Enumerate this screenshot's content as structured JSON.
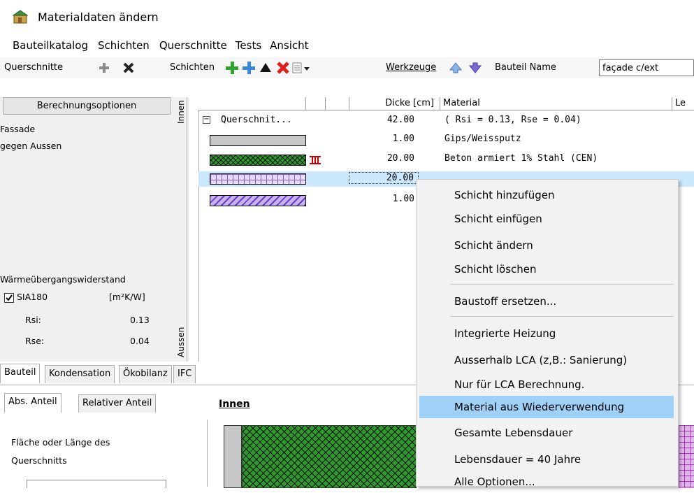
{
  "window": {
    "title": "Materialdaten ändern"
  },
  "menu": [
    "Bauteilkatalog",
    "Schichten",
    "Querschnitte",
    "Tests",
    "Ansicht"
  ],
  "toolbar": {
    "querschnitte_label": "Querschnitte",
    "schichten_label": "Schichten",
    "werkzeuge_label": "Werkzeuge",
    "bauteil_name_label": "Bauteil Name",
    "bauteil_name_value": "façade c/ext"
  },
  "left": {
    "calc_button": "Berechnungsoptionen",
    "innen": "Innen",
    "aussen": "Aussen",
    "desc_line1": "Fassade",
    "desc_line2": "gegen Aussen",
    "resistance_title": "Wärmeübergangswiderstand",
    "sia_label": "SIA180",
    "unit": "[m²K/W]",
    "rsi_label": "Rsi:",
    "rsi_value": "0.13",
    "rse_label": "Rse:",
    "rse_value": "0.04"
  },
  "grid": {
    "headers": {
      "dicke": "Dicke [cm]",
      "material": "Material",
      "le": "Le"
    },
    "rows": [
      {
        "name": "Querschnit...",
        "dicke": "42.00",
        "material": "( Rsi = 0.13, Rse = 0.04)"
      },
      {
        "dicke": "1.00",
        "material": "Gips/Weissputz"
      },
      {
        "dicke": "20.00",
        "material": "Beton armiert 1% Stahl (CEN)"
      },
      {
        "dicke": "20.00",
        "material": ""
      },
      {
        "dicke": "1.00",
        "material": ""
      }
    ]
  },
  "context_menu": {
    "items": [
      "Schicht hinzufügen",
      "Schicht einfügen",
      "Schicht ändern",
      "Schicht löschen",
      "Baustoff ersetzen...",
      "Integrierte Heizung",
      "Ausserhalb LCA (z,B.: Sanierung)",
      "Nur für LCA Berechnung.",
      "Material aus Wiederverwendung",
      "Gesamte Lebensdauer",
      "Lebensdauer = 40 Jahre",
      "Alle  Optionen..."
    ],
    "highlighted": "Material aus Wiederverwendung"
  },
  "tabs": {
    "main": [
      "Bauteil",
      "Kondensation",
      "Ökobilanz",
      "IFC"
    ],
    "sub": [
      "Abs. Anteil",
      "Relativer Anteil"
    ]
  },
  "bottom": {
    "innen_heading": "Innen",
    "flaeche_line1": "Fläche oder Länge des",
    "flaeche_line2": "Querschnitts"
  },
  "colors": {
    "highlight": "#9fd0f8",
    "selected_row": "#cce8ff",
    "green_hatch": "#2e9a2e",
    "purple_hatch": "#8b5cd6",
    "red_icon": "#d11"
  }
}
